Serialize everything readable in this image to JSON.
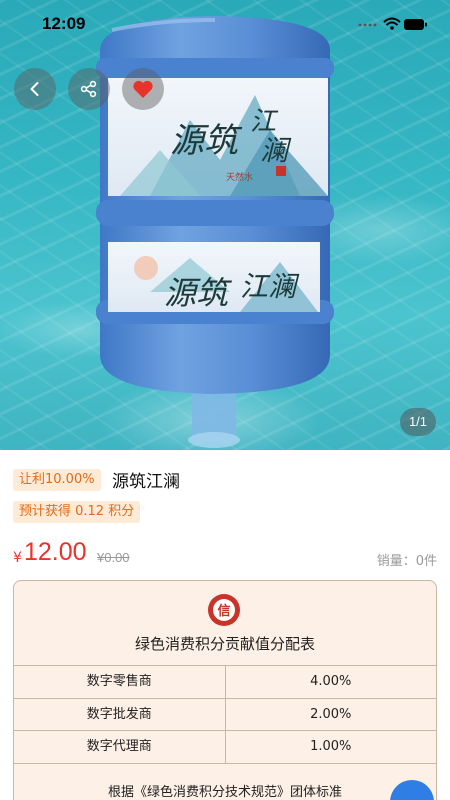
{
  "status_bar": {
    "time": "12:09"
  },
  "hero": {
    "image_counter": "1/1",
    "bottle_brand": "源筑江澜",
    "bottle_sublabel": "天然水"
  },
  "product": {
    "promo_tag": "让利10.00%",
    "title": "源筑江澜",
    "points_tag": "预计获得 0.12 积分",
    "price_symbol": "¥",
    "price": "12.00",
    "original_price": "¥0.00",
    "sales": "销量：0件"
  },
  "contribution_card": {
    "logo_char": "信",
    "title": "绿色消费积分贡献值分配表",
    "rows": [
      {
        "role": "数字零售商",
        "percent": "4.00%"
      },
      {
        "role": "数字批发商",
        "percent": "2.00%"
      },
      {
        "role": "数字代理商",
        "percent": "1.00%"
      }
    ],
    "footer": "根据《绿色消费积分技术规范》团体标准"
  },
  "colors": {
    "accent_red": "#e8332a",
    "tag_bg": "#fdebd7",
    "tag_text": "#e36b16",
    "card_bg": "#fdf0e6",
    "float_button": "#2e7ee6"
  }
}
